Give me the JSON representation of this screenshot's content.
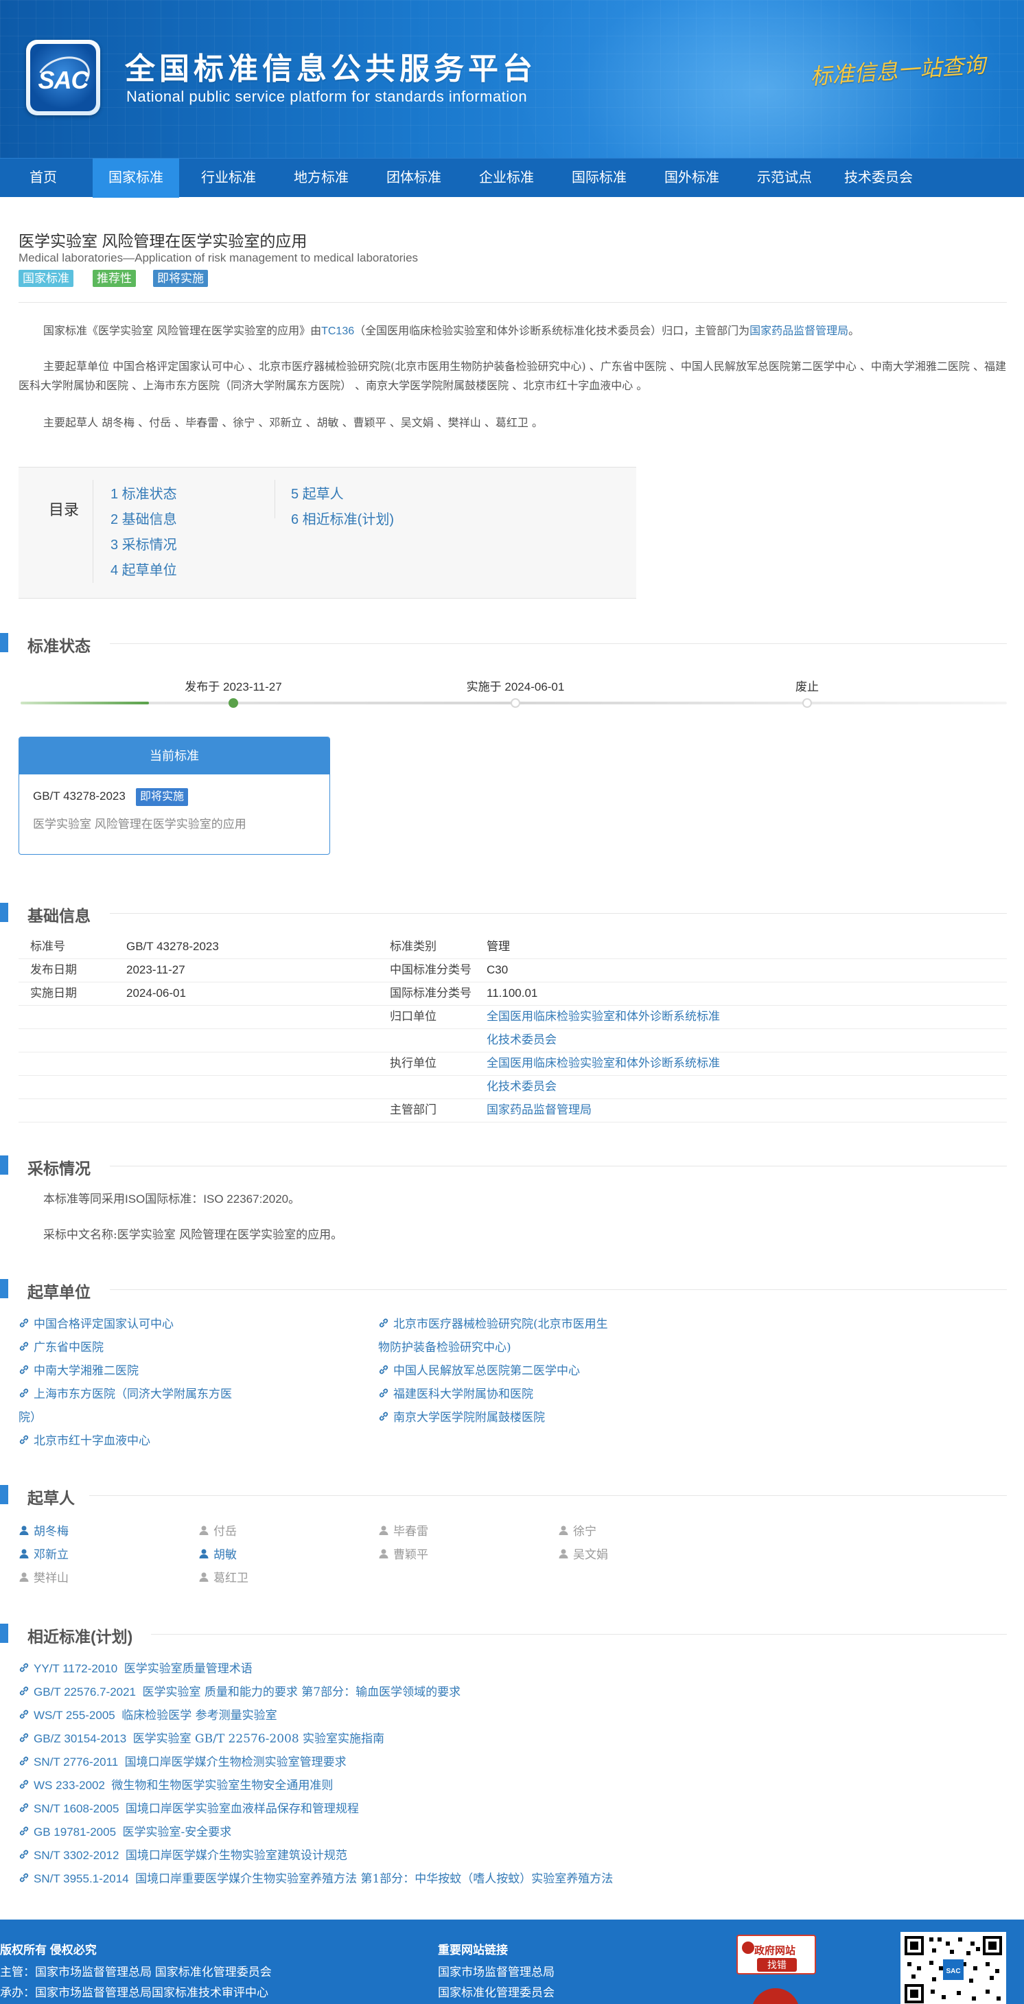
{
  "header": {
    "logo_text": "SAC",
    "site_title": "全国标准信息公共服务平台",
    "site_subtitle": "National public service platform  for standards information",
    "slogan": "标准信息一站查询"
  },
  "nav": {
    "items": [
      "首页",
      "国家标准",
      "行业标准",
      "地方标准",
      "团体标准",
      "企业标准",
      "国际标准",
      "国外标准",
      "示范试点",
      "技术委员会"
    ],
    "active_index": 1
  },
  "standard": {
    "title": "医学实验室 风险管理在医学实验室的应用",
    "en_title": "Medical laboratories—Application of risk management to medical laboratories",
    "tags": [
      {
        "label": "国家标准",
        "color": "#5bc0de"
      },
      {
        "label": "推荐性",
        "color": "#5cb85c"
      },
      {
        "label": "即将实施",
        "color": "#428bca"
      }
    ]
  },
  "intro": {
    "p1_prefix": "国家标准《医学实验室 风险管理在医学实验室的应用》由",
    "p1_tc": "TC136",
    "p1_mid": "（全国医用临床检验实验室和体外诊断系统标准化技术委员会）归口，主管部门为",
    "p1_dept": "国家药品监督管理局",
    "p1_end": "。",
    "p2": "主要起草单位 中国合格评定国家认可中心 、北京市医疗器械检验研究院(北京市医用生物防护装备检验研究中心) 、广东省中医院 、中国人民解放军总医院第二医学中心 、中南大学湘雅二医院 、福建医科大学附属协和医院 、上海市东方医院（同济大学附属东方医院） 、南京大学医学院附属鼓楼医院 、北京市红十字血液中心 。",
    "p3": "主要起草人 胡冬梅 、付岳 、毕春雷 、徐宁 、邓新立 、胡敏 、曹颖平 、吴文娟 、樊祥山 、葛红卫 。"
  },
  "toc": {
    "label": "目录",
    "entries": [
      "1 标准状态",
      "2 基础信息",
      "3 采标情况",
      "4 起草单位",
      "5 起草人",
      "6 相近标准(计划)"
    ]
  },
  "status": {
    "section_title": "标准状态",
    "timeline": [
      {
        "label": "发布于 2023-11-27",
        "done": true
      },
      {
        "label": "实施于 2024-06-01",
        "done": false
      },
      {
        "label": "废止",
        "done": false
      }
    ],
    "progress": 0.13,
    "card_head": "当前标准",
    "card_code": "GB/T 43278-2023",
    "card_badge": "即将实施",
    "card_name": "医学实验室 风险管理在医学实验室的应用"
  },
  "basic": {
    "section_title": "基础信息",
    "left": [
      {
        "k": "标准号",
        "v": "GB/T 43278-2023"
      },
      {
        "k": "发布日期",
        "v": "2023-11-27"
      },
      {
        "k": "实施日期",
        "v": "2024-06-01"
      }
    ],
    "right": [
      {
        "k": "标准类别",
        "v": "管理"
      },
      {
        "k": "中国标准分类号",
        "v": "C30"
      },
      {
        "k": "国际标准分类号",
        "v": "11.100.01"
      }
    ],
    "gk_key": "归口单位",
    "gk_v1": "全国医用临床检验实验室和体外诊断系统标准",
    "gk_v2": "化技术委员会",
    "zx_key": "执行单位",
    "zx_v1": "全国医用临床检验实验室和体外诊断系统标准",
    "zx_v2": "化技术委员会",
    "zg_key": "主管部门",
    "zg_v": "国家药品监督管理局"
  },
  "adoption": {
    "section_title": "采标情况",
    "l1_a": "本标准等同采用",
    "l1_b": "ISO",
    "l1_c": "国际标准：",
    "l1_d": "ISO 22367:2020",
    "l1_e": "。",
    "l2": "采标中文名称:医学实验室 风险管理在医学实验室的应用。"
  },
  "units": {
    "section_title": "起草单位",
    "items": [
      "中国合格评定国家认可中心",
      "北京市医疗器械检验研究院(北京市医用生",
      "物防护装备检验研究中心)",
      "广东省中医院",
      "中南大学湘雅二医院",
      "中国人民解放军总医院第二医学中心",
      "上海市东方医院（同济大学附属东方医",
      "院）",
      "福建医科大学附属协和医院",
      "南京大学医学院附属鼓楼医院",
      "北京市红十字血液中心"
    ]
  },
  "people": {
    "section_title": "起草人",
    "items": [
      {
        "name": "胡冬梅",
        "linked": true
      },
      {
        "name": "付岳",
        "linked": false
      },
      {
        "name": "毕春雷",
        "linked": false
      },
      {
        "name": "徐宁",
        "linked": false
      },
      {
        "name": "邓新立",
        "linked": true
      },
      {
        "name": "胡敏",
        "linked": true
      },
      {
        "name": "曹颖平",
        "linked": false
      },
      {
        "name": "吴文娟",
        "linked": false
      },
      {
        "name": "樊祥山",
        "linked": false
      },
      {
        "name": "葛红卫",
        "linked": false
      }
    ]
  },
  "related": {
    "section_title": "相近标准(计划)",
    "items": [
      {
        "code": "YY/T 1172-2010",
        "name": "医学实验室质量管理术语"
      },
      {
        "code": "GB/T 22576.7-2021",
        "name": "医学实验室 质量和能力的要求 第7部分：输血医学领域的要求"
      },
      {
        "code": "WS/T 255-2005",
        "name": "临床检验医学 参考测量实验室"
      },
      {
        "code": "GB/Z 30154-2013",
        "name": "医学实验室 GB/T 22576-2008 实验室实施指南"
      },
      {
        "code": "SN/T 2776-2011",
        "name": "国境口岸医学媒介生物检测实验室管理要求"
      },
      {
        "code": "WS 233-2002",
        "name": "微生物和生物医学实验室生物安全通用准则"
      },
      {
        "code": "SN/T 1608-2005",
        "name": "国境口岸医学实验室血液样品保存和管理规程"
      },
      {
        "code": "GB 19781-2005",
        "name": "医学实验室-安全要求"
      },
      {
        "code": "SN/T 3302-2012",
        "name": "国境口岸医学媒介生物实验室建筑设计规范"
      },
      {
        "code": "SN/T 3955.1-2014",
        "name": "国境口岸重要医学媒介生物实验室养殖方法 第1部分：中华按蚊（嗜人按蚊）实验室养殖方法"
      }
    ]
  },
  "footer": {
    "copyright": "版权所有 侵权必究",
    "host": "主管：国家市场监督管理总局 国家标准化管理委员会",
    "organizer": "承办：国家市场监督管理总局国家标准技术审评中心",
    "links_title": "重要网站链接",
    "link1": "国家市场监督管理总局",
    "link2": "国家标准化管理委员会",
    "gov_badge_top": "政府网站",
    "gov_badge_btn": "找错"
  },
  "colors": {
    "nav_bg": "#1467b9",
    "accent": "#2f86d6",
    "link": "#337ab7",
    "timeline_done": "#5aa14a"
  }
}
